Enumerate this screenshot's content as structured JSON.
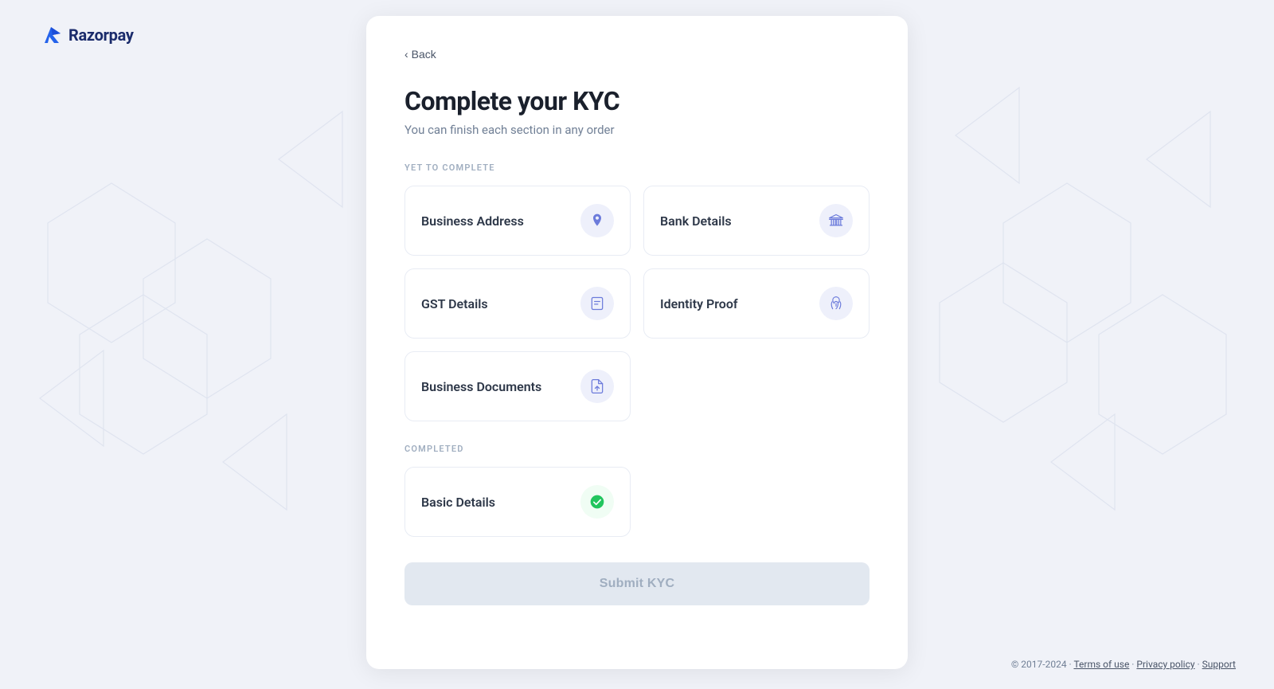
{
  "logo": {
    "text": "Razorpay",
    "icon_alt": "razorpay-logo"
  },
  "header": {
    "back_label": "Back"
  },
  "page": {
    "title": "Complete your KYC",
    "subtitle": "You can finish each section in any order"
  },
  "yet_to_complete": {
    "section_label": "YET TO COMPLETE",
    "items": [
      {
        "id": "business-address",
        "label": "Business Address",
        "icon": "location"
      },
      {
        "id": "bank-details",
        "label": "Bank Details",
        "icon": "bank"
      },
      {
        "id": "gst-details",
        "label": "GST Details",
        "icon": "document"
      },
      {
        "id": "identity-proof",
        "label": "Identity Proof",
        "icon": "fingerprint"
      },
      {
        "id": "business-documents",
        "label": "Business Documents",
        "icon": "file-upload"
      }
    ]
  },
  "completed": {
    "section_label": "COMPLETED",
    "items": [
      {
        "id": "basic-details",
        "label": "Basic Details",
        "icon": "check"
      }
    ]
  },
  "submit": {
    "label": "Submit KYC"
  },
  "footer": {
    "copyright": "© 2017-2024 ·",
    "links": [
      "Terms of use",
      "Privacy policy",
      "Support"
    ],
    "separators": [
      "·",
      "·"
    ]
  }
}
